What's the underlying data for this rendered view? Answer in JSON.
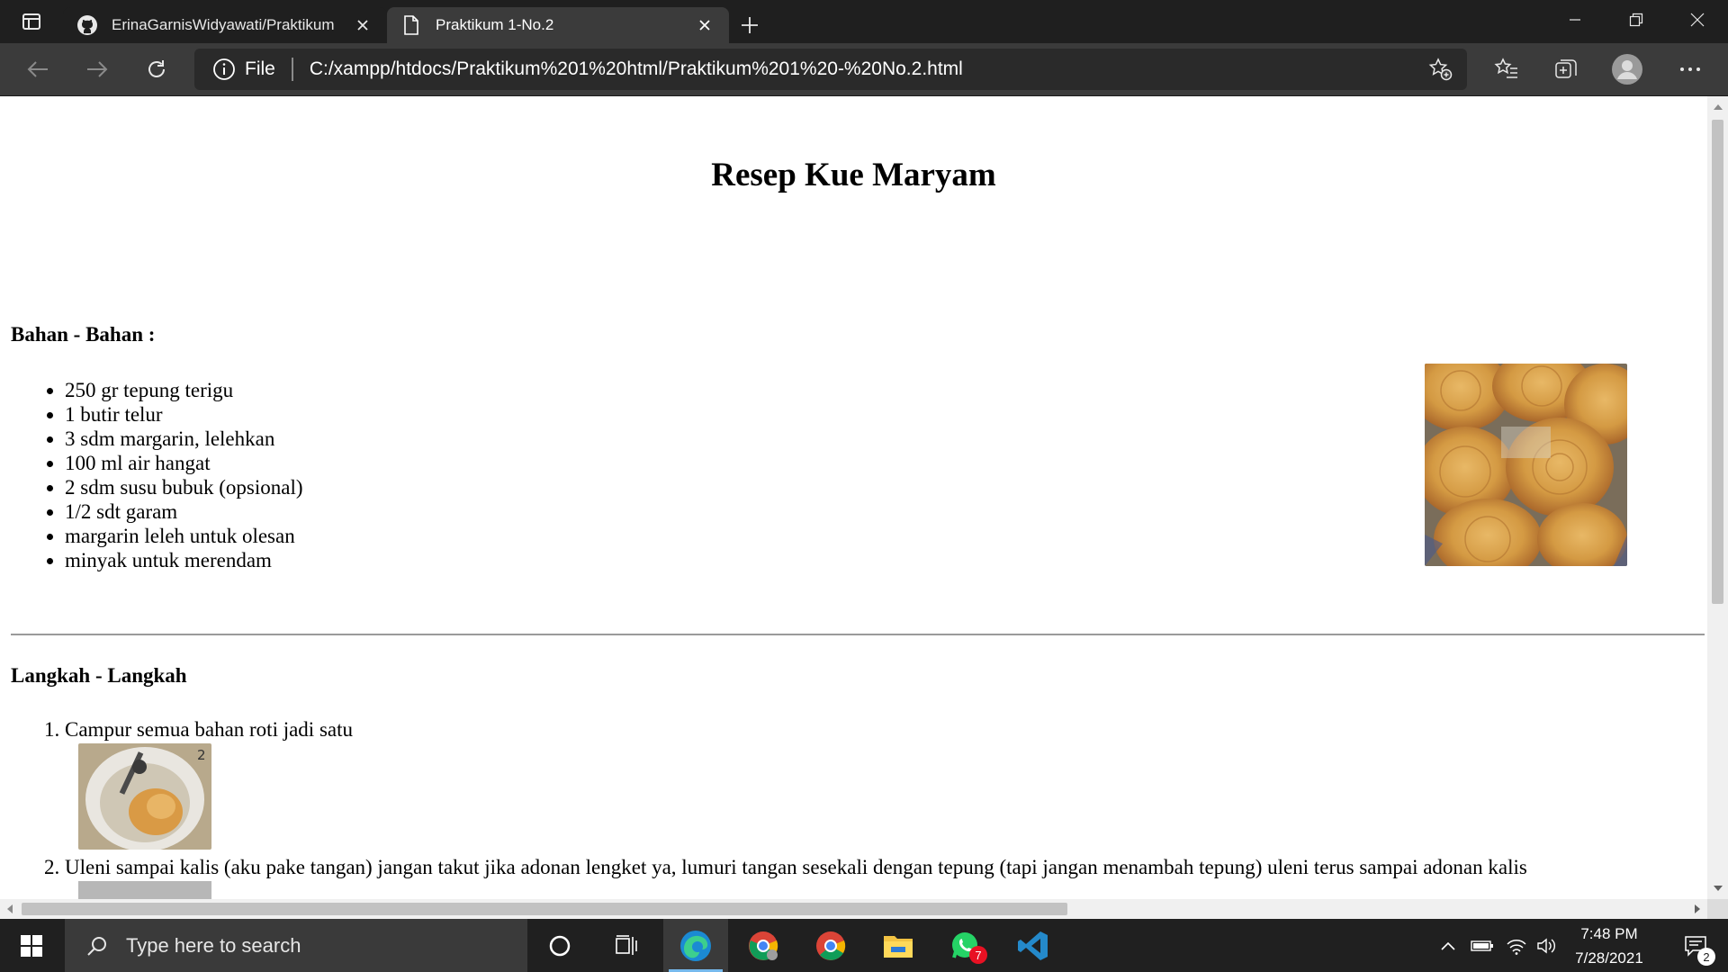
{
  "browser": {
    "tabs": [
      {
        "title": "ErinaGarnisWidyawati/Praktikum",
        "icon": "github-icon",
        "active": false
      },
      {
        "title": "Praktikum 1-No.2",
        "icon": "file-icon",
        "active": true
      }
    ],
    "address": {
      "protocol_label": "File",
      "url": "C:/xampp/htdocs/Praktikum%201%20html/Praktikum%201%20-%20No.2.html"
    }
  },
  "page": {
    "title": "Resep Kue Maryam",
    "ingredients_heading": "Bahan - Bahan :",
    "ingredients": [
      "250 gr tepung terigu",
      "1 butir telur",
      "3 sdm margarin, lelehkan",
      "100 ml air hangat",
      "2 sdm susu bubuk (opsional)",
      "1/2 sdt garam",
      "margarin leleh untuk olesan",
      "minyak untuk merendam"
    ],
    "steps_heading": "Langkah - Langkah",
    "steps": [
      "Campur semua bahan roti jadi satu",
      "Uleni sampai kalis (aku pake tangan) jangan takut jika adonan lengket ya, lumuri tangan sesekali dengan tepung (tapi jangan menambah tepung) uleni terus sampai adonan kalis"
    ],
    "step1_image_number": "2"
  },
  "taskbar": {
    "search_placeholder": "Type here to search",
    "whatsapp_badge": "7",
    "time": "7:48 PM",
    "date": "7/28/2021",
    "notification_count": "2"
  },
  "colors": {
    "tab_bar": "#1f1f1f",
    "toolbar": "#3b3b3b",
    "taskbar": "#202020",
    "accent": "#76b9ed",
    "badge_red": "#e81123"
  }
}
